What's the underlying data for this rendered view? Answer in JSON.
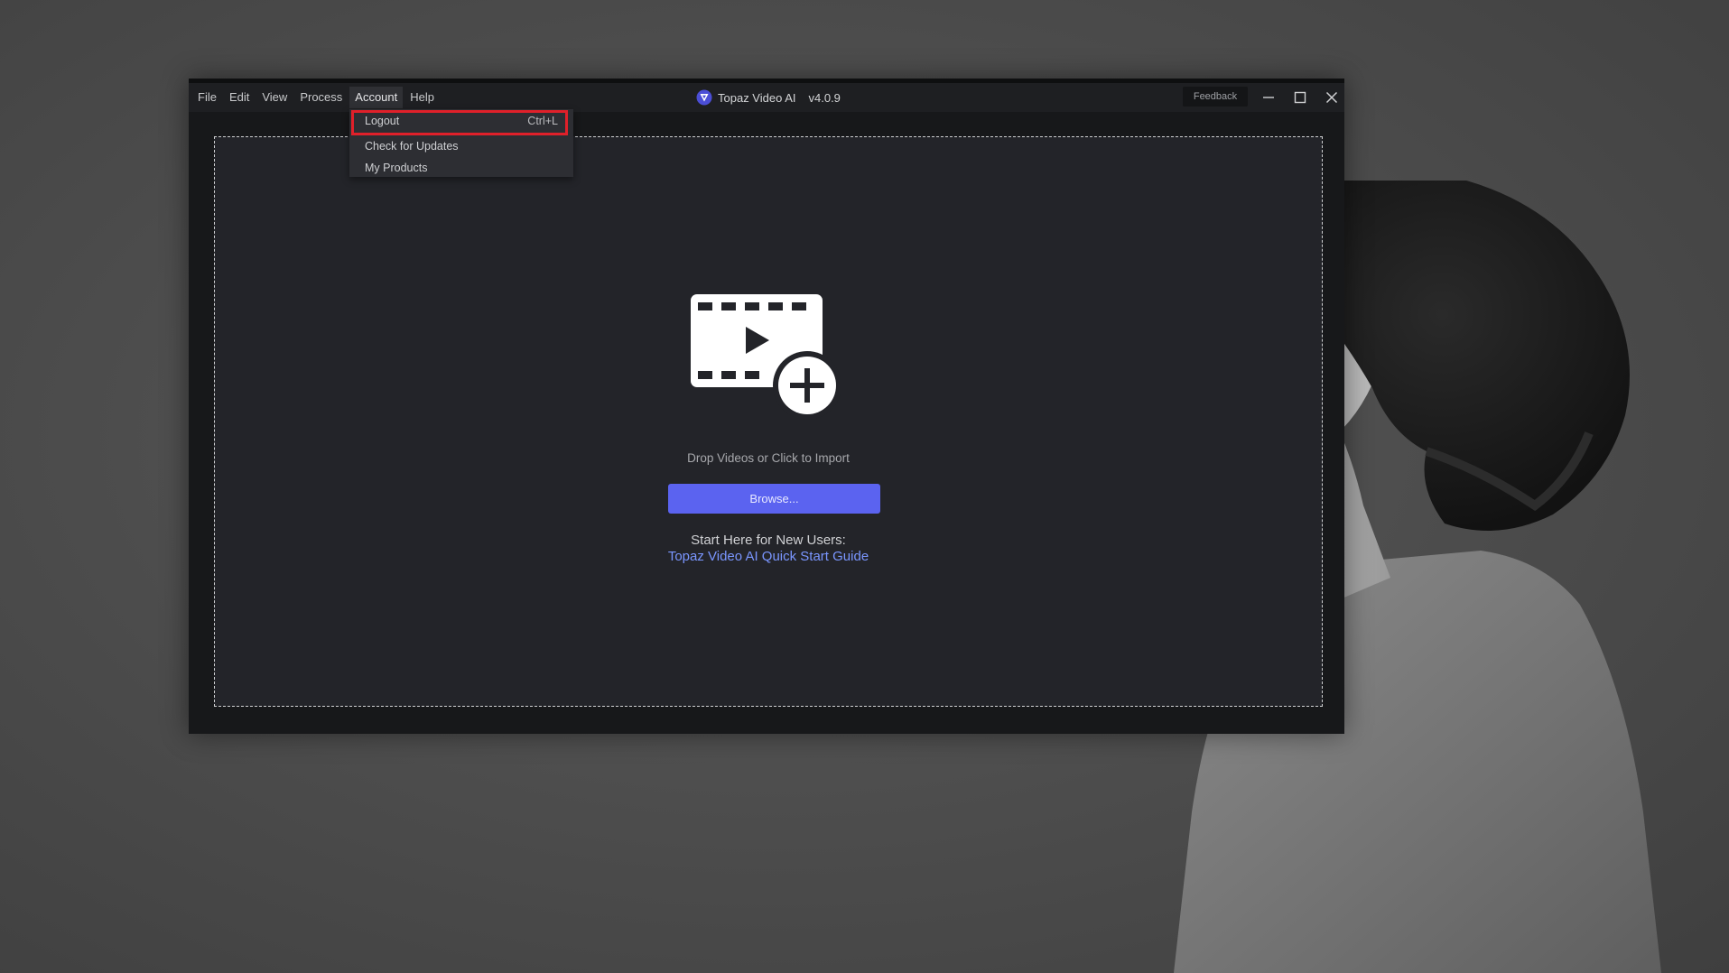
{
  "window": {
    "app_name": "Topaz Video AI",
    "version": "v4.0.9",
    "feedback_label": "Feedback"
  },
  "menubar": {
    "items": [
      {
        "label": "File"
      },
      {
        "label": "Edit"
      },
      {
        "label": "View"
      },
      {
        "label": "Process"
      },
      {
        "label": "Account",
        "active": true
      },
      {
        "label": "Help"
      }
    ]
  },
  "account_menu": {
    "items": [
      {
        "label": "Logout",
        "shortcut": "Ctrl+L",
        "highlighted": true
      },
      {
        "label": "Check for Updates"
      },
      {
        "label": "My Products"
      }
    ]
  },
  "drop_zone": {
    "instruction": "Drop Videos or Click to Import",
    "browse_label": "Browse...",
    "start_here": "Start Here for New Users:",
    "guide_link": "Topaz Video AI Quick Start Guide"
  },
  "colors": {
    "accent": "#5b63f0",
    "link": "#7a96ff",
    "highlight_border": "#e0202a"
  },
  "icons": {
    "import": "video-add-icon",
    "logo": "topaz-logo-icon",
    "minimize": "minimize-icon",
    "maximize": "maximize-icon",
    "close": "close-icon"
  }
}
